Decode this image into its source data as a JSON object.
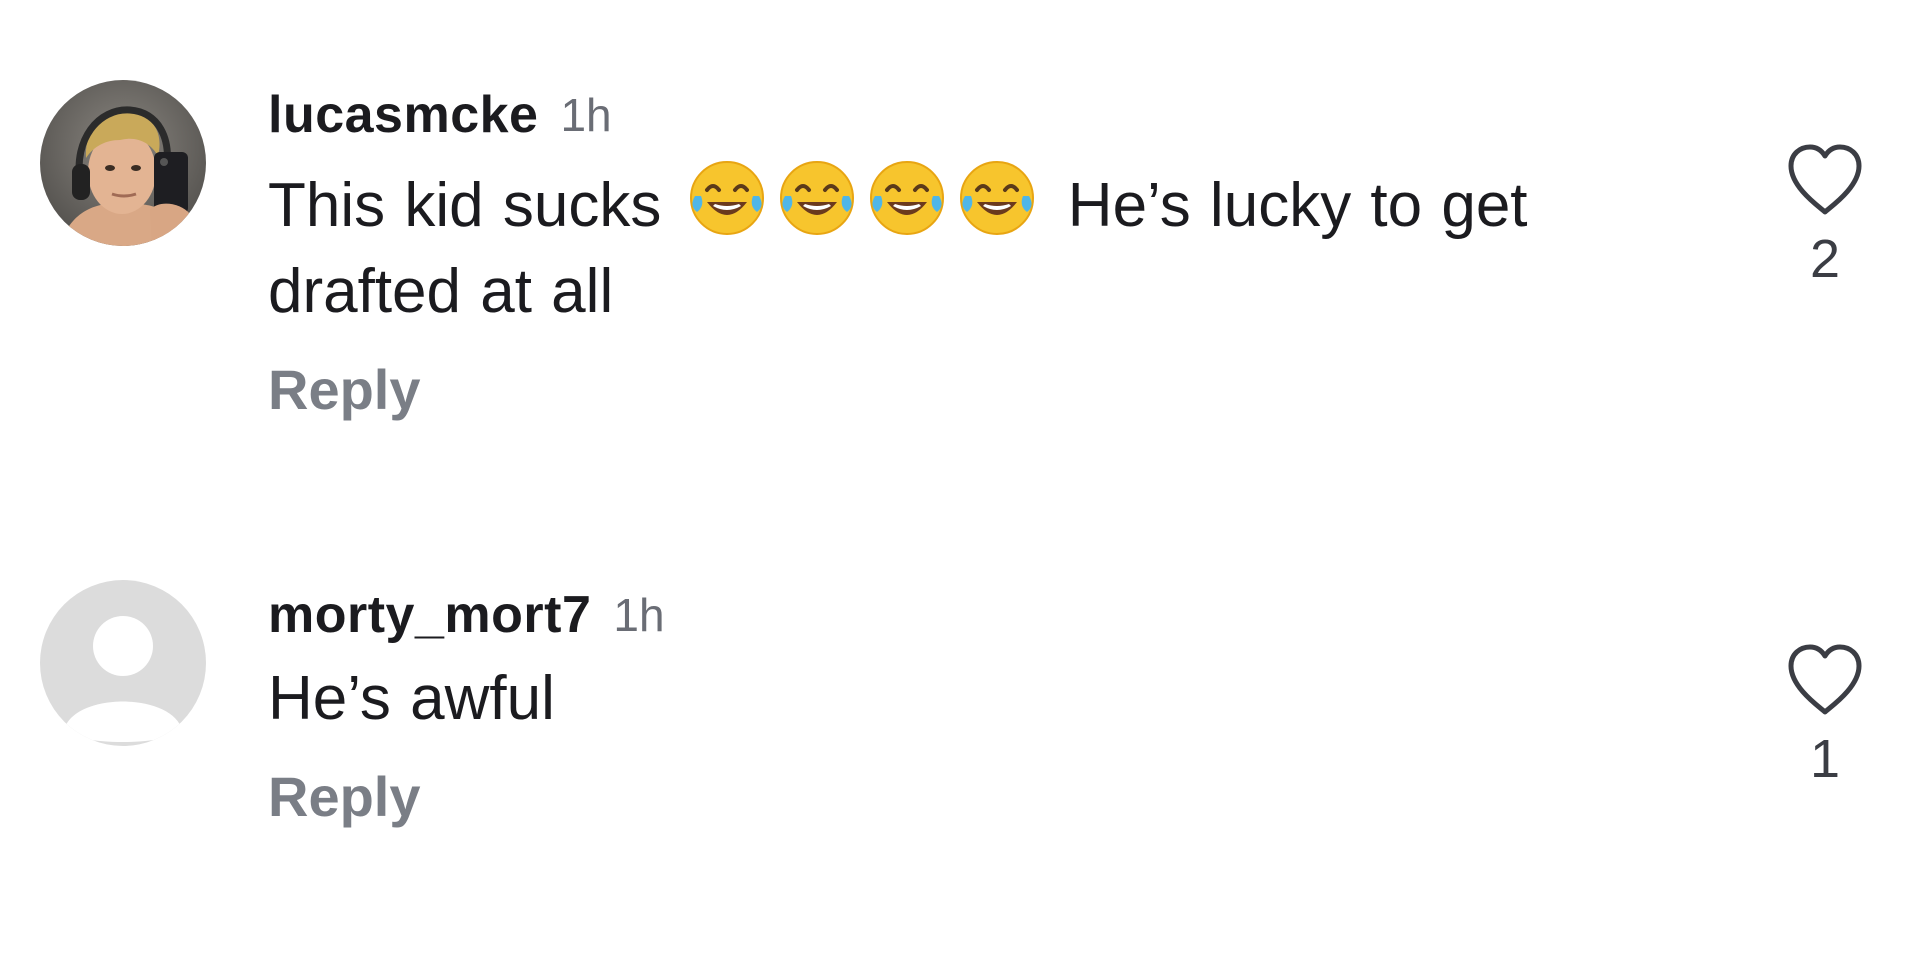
{
  "comments": [
    {
      "username": "lucasmcke",
      "time": "1h",
      "text_before": "This kid sucks",
      "emojis": [
        "face-with-tears-of-joy",
        "face-with-tears-of-joy",
        "face-with-tears-of-joy",
        "face-with-tears-of-joy"
      ],
      "text_after": "He’s lucky to get drafted at all",
      "reply_label": "Reply",
      "like_count": "2",
      "avatar": "profile-photo"
    },
    {
      "username": "morty_mort7",
      "time": "1h",
      "text": "He’s awful",
      "reply_label": "Reply",
      "like_count": "1",
      "avatar": "default-avatar"
    }
  ],
  "colors": {
    "text": "#1b1b1f",
    "secondary": "#6a6d75",
    "reply": "#7a7e86",
    "icon": "#3b3d44",
    "default_avatar_bg": "#dcdcdc"
  },
  "icons": {
    "like": "heart-outline-icon"
  }
}
